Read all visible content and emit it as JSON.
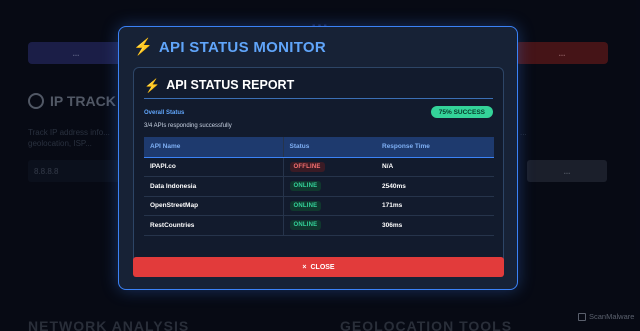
{
  "background": {
    "page_title": "...",
    "left_button": "...",
    "right_button": "...",
    "section_title": "IP TRACK",
    "section_desc_1": "Track IP address info...",
    "section_desc_2": "geolocation, ISP...",
    "section_desc_r": "...",
    "input_value": "8.8.8.8",
    "search_label": "...",
    "bottom_left": "NETWORK ANALYSIS",
    "bottom_right": "GEOLOCATION TOOLS",
    "watermark": "ScanMalware"
  },
  "modal": {
    "title": "API STATUS MONITOR",
    "icon": "lightning-bolt-icon",
    "report": {
      "title": "API STATUS REPORT",
      "overall_label": "Overall Status",
      "badge": "75% SUCCESS",
      "summary": "3/4 APIs responding successfully",
      "columns": [
        "API Name",
        "Status",
        "Response Time"
      ],
      "rows": [
        {
          "name": "IPAPI.co",
          "status": "OFFLINE",
          "response": "N/A"
        },
        {
          "name": "Data Indonesia",
          "status": "ONLINE",
          "response": "2540ms"
        },
        {
          "name": "OpenStreetMap",
          "status": "ONLINE",
          "response": "171ms"
        },
        {
          "name": "RestCountries",
          "status": "ONLINE",
          "response": "306ms"
        }
      ]
    },
    "close_icon": "×",
    "close_label": "CLOSE"
  },
  "colors": {
    "accent": "#3b82f6",
    "success": "#34d399",
    "danger": "#e23b3b",
    "offline": "#f87171"
  }
}
